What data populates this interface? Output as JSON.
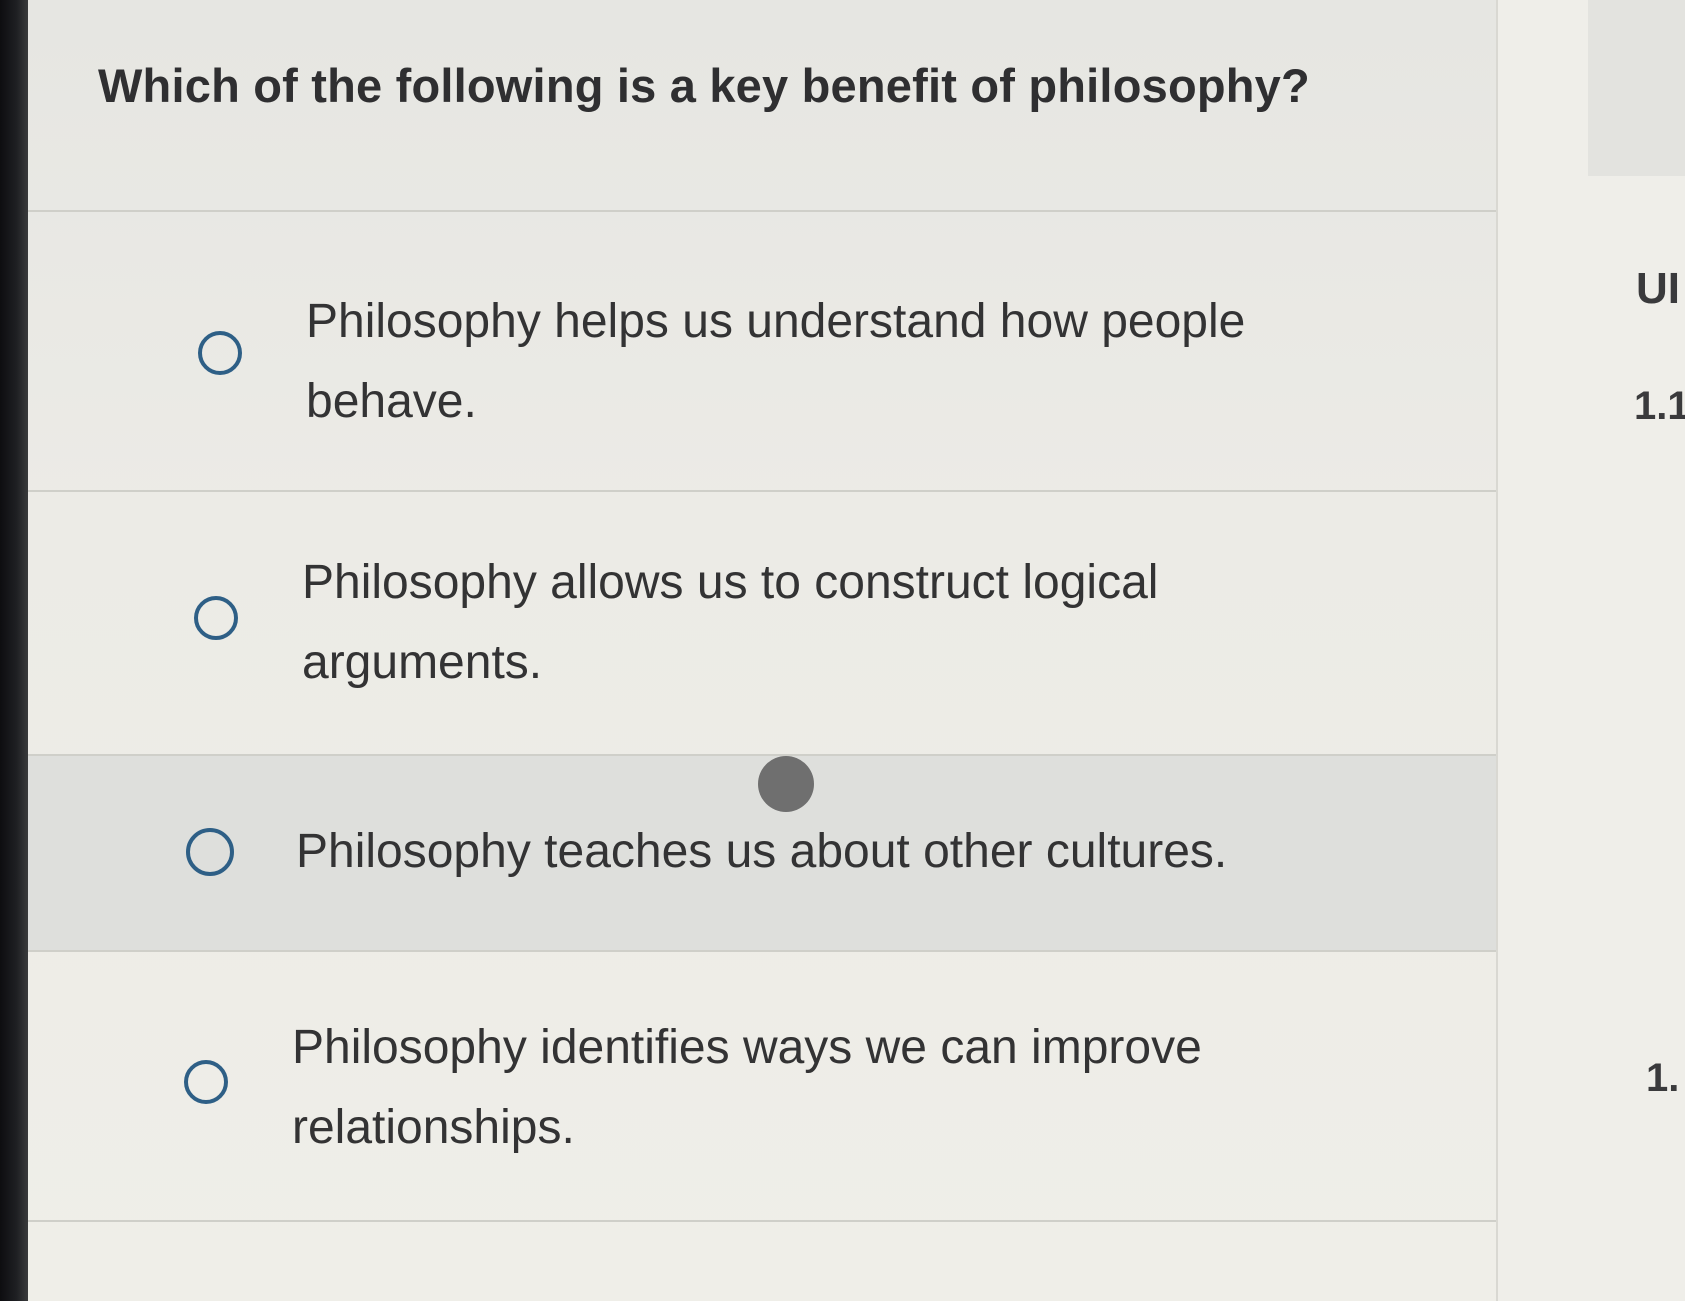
{
  "question": {
    "text": "Which of the following is a key benefit of philosophy?"
  },
  "options": [
    {
      "label": "Philosophy helps us understand how people behave.",
      "line1": "Philosophy helps us understand how people",
      "line2": "behave.",
      "selected": false
    },
    {
      "label": "Philosophy allows us to construct logical arguments.",
      "line1": "Philosophy allows us to construct logical",
      "line2": "arguments.",
      "selected": false
    },
    {
      "label": "Philosophy teaches us about other cultures.",
      "line1": "Philosophy teaches us about other cultures.",
      "line2": "",
      "selected": false
    },
    {
      "label": "Philosophy identifies ways we can improve relationships.",
      "line1": "Philosophy identifies ways we can improve",
      "line2": "relationships.",
      "selected": false
    }
  ],
  "side_panel": {
    "heading_fragment": "UI",
    "item_1": "1.1",
    "item_2": "1."
  },
  "colors": {
    "radio_border": "#2e5f86",
    "text": "#333334",
    "highlight_row": "#dedfdc"
  }
}
